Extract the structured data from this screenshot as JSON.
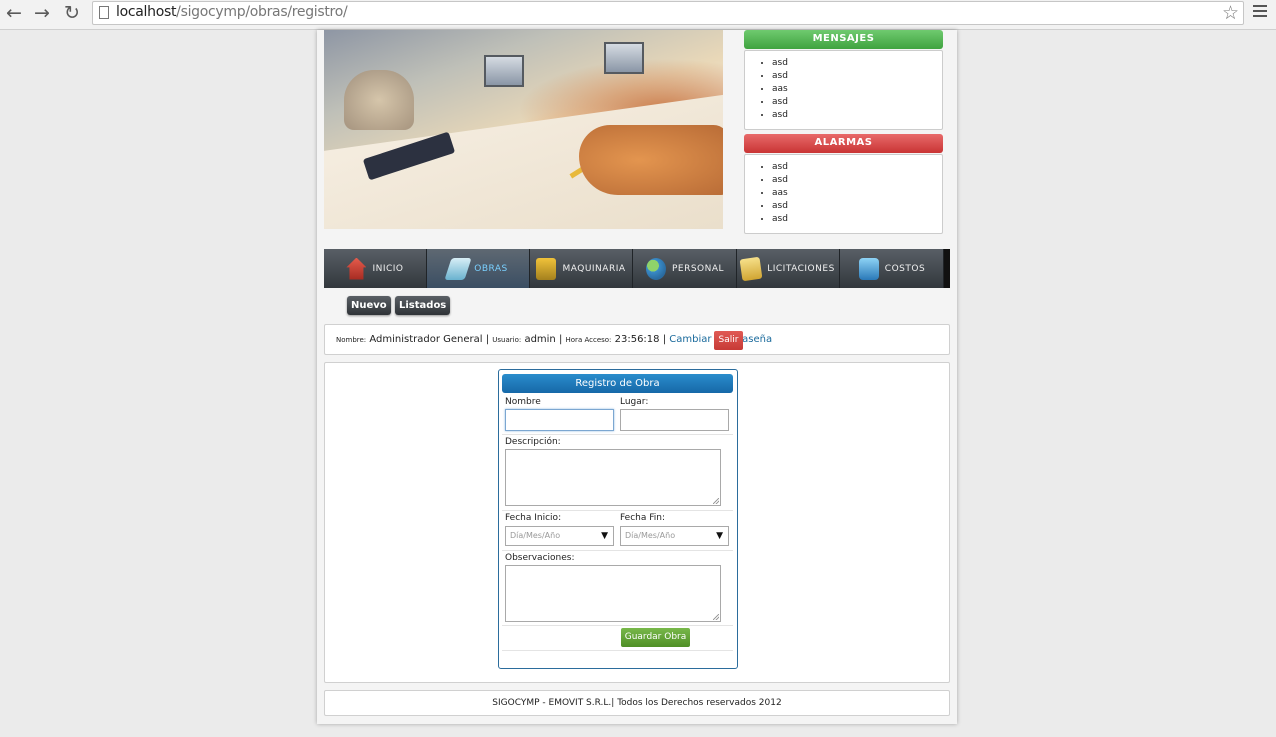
{
  "browser": {
    "url_host": "localhost",
    "url_path": "/sigocymp/obras/registro/"
  },
  "mensajes": {
    "title": "MENSAJES",
    "items": [
      "asd",
      "asd",
      "aas",
      "asd",
      "asd"
    ]
  },
  "alarmas": {
    "title": "ALARMAS",
    "items": [
      "asd",
      "asd",
      "aas",
      "asd",
      "asd"
    ]
  },
  "nav": {
    "items": [
      {
        "label": "INICIO",
        "icon": "home-icon"
      },
      {
        "label": "OBRAS",
        "icon": "obras-icon"
      },
      {
        "label": "MAQUINARIA",
        "icon": "maquinaria-icon"
      },
      {
        "label": "PERSONAL",
        "icon": "personal-icon"
      },
      {
        "label": "LICITACIONES",
        "icon": "licitaciones-icon"
      },
      {
        "label": "COSTOS",
        "icon": "costos-icon"
      }
    ],
    "active": "OBRAS"
  },
  "subnav": {
    "nuevo": "Nuevo",
    "listados": "Listados"
  },
  "user": {
    "nombre_label": "Nombre:",
    "nombre": "Administrador General",
    "usuario_label": "Usuario:",
    "usuario": "admin",
    "hora_label": "Hora Acceso:",
    "hora": "23:56:18",
    "cambiar": "Cambiar Contraseña",
    "salir": "Salir"
  },
  "form": {
    "title": "Registro de Obra",
    "nombre_label": "Nombre",
    "lugar_label": "Lugar:",
    "descripcion_label": "Descripción:",
    "fecha_inicio_label": "Fecha Inicio:",
    "fecha_fin_label": "Fecha Fin:",
    "fecha_placeholder": "Día/Mes/Año",
    "observaciones_label": "Observaciones:",
    "guardar": "Guardar Obra"
  },
  "footer": {
    "text": "SIGOCYMP - EMOVIT S.R.L.| Todos los Derechos reservados 2012"
  }
}
